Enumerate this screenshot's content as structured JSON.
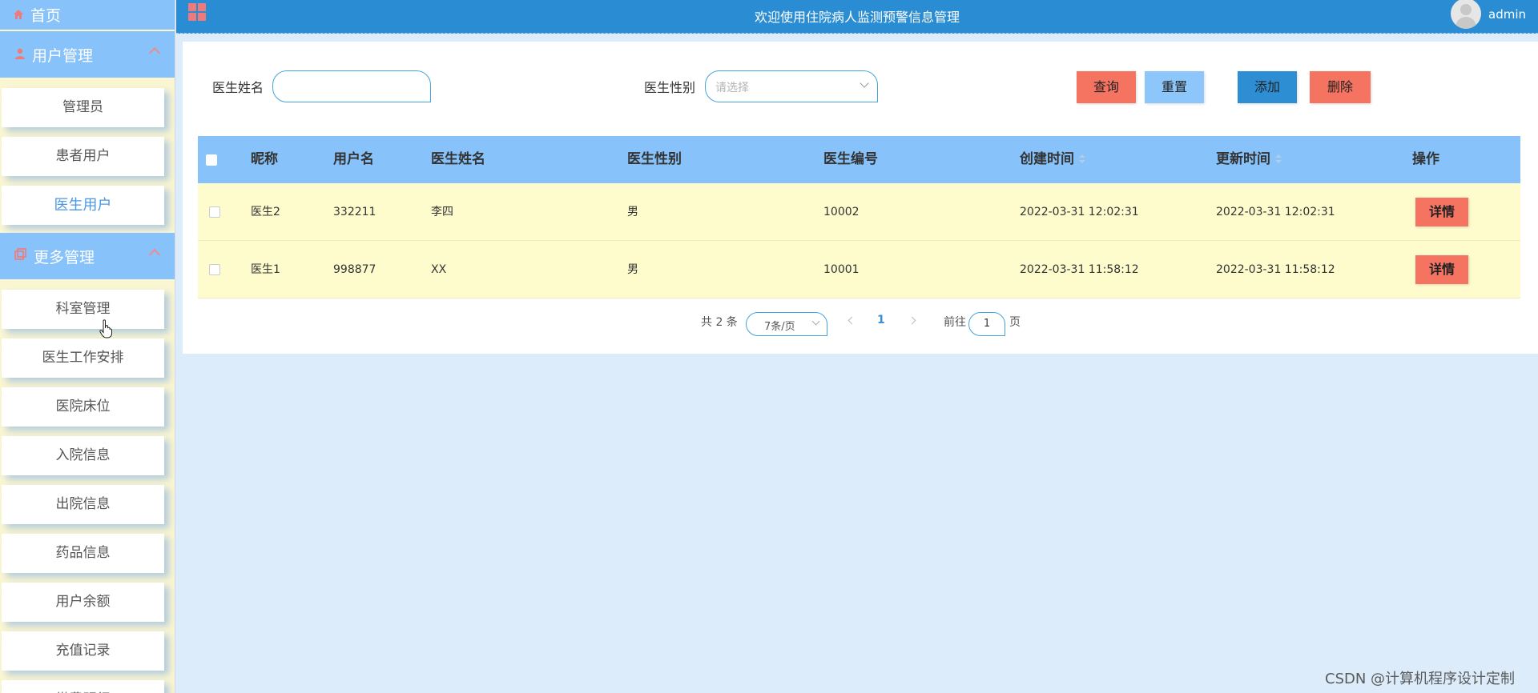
{
  "sidebar": {
    "home": "首页",
    "group1": {
      "title": "用户管理",
      "items": [
        {
          "label": "管理员"
        },
        {
          "label": "患者用户"
        },
        {
          "label": "医生用户"
        }
      ]
    },
    "group2": {
      "title": "更多管理",
      "items": [
        {
          "label": "科室管理"
        },
        {
          "label": "医生工作安排"
        },
        {
          "label": "医院床位"
        },
        {
          "label": "入院信息"
        },
        {
          "label": "出院信息"
        },
        {
          "label": "药品信息"
        },
        {
          "label": "用户余额"
        },
        {
          "label": "充值记录"
        },
        {
          "label": "缴费明细"
        }
      ]
    }
  },
  "topbar": {
    "title": "欢迎使用住院病人监测预警信息管理",
    "user": "admin"
  },
  "search": {
    "name_label": "医生姓名",
    "name_value": "",
    "gender_label": "医生性别",
    "gender_placeholder": "请选择",
    "query": "查询",
    "reset": "重置",
    "add": "添加",
    "delete": "删除"
  },
  "table": {
    "headers": [
      "昵称",
      "用户名",
      "医生姓名",
      "医生性别",
      "医生编号",
      "创建时间",
      "更新时间",
      "操作"
    ],
    "rows": [
      {
        "nickname": "医生2",
        "username": "332211",
        "name": "李四",
        "gender": "男",
        "number": "10002",
        "created": "2022-03-31 12:02:31",
        "updated": "2022-03-31 12:02:31",
        "action": "详情"
      },
      {
        "nickname": "医生1",
        "username": "998877",
        "name": "XX",
        "gender": "男",
        "number": "10001",
        "created": "2022-03-31 11:58:12",
        "updated": "2022-03-31 11:58:12",
        "action": "详情"
      }
    ]
  },
  "pagination": {
    "total": "共 2 条",
    "page_size": "7条/页",
    "current": "1",
    "goto": "前往",
    "goto_value": "1",
    "page_unit": "页"
  },
  "watermark": "CSDN @计算机程序设计定制",
  "colors": {
    "sidebar_header": "#87c3fa",
    "topbar": "#2a8dd3",
    "row_bg": "#fefbcd",
    "danger": "#f57461",
    "background": "#dcecfb"
  }
}
